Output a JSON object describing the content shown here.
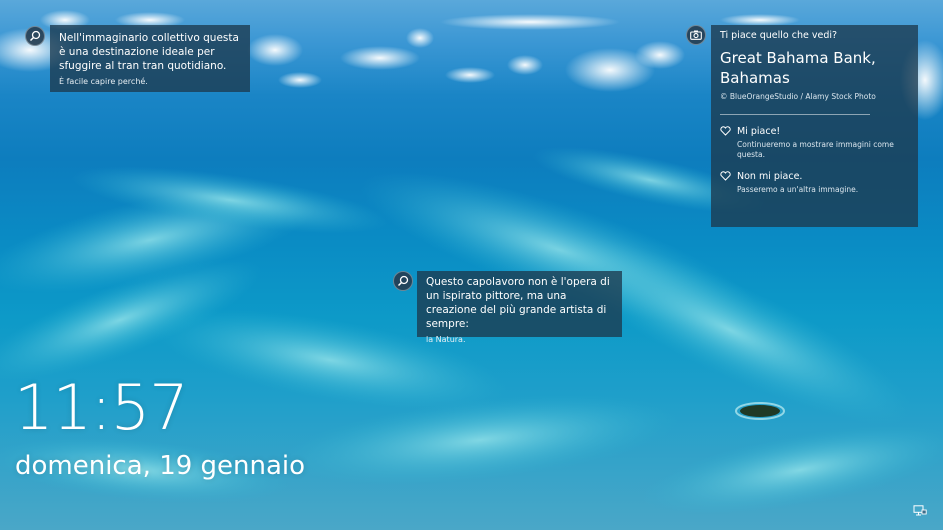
{
  "background": {
    "description_color_sky": "#4fa3d8",
    "description_color_sea": "#0b86c4"
  },
  "hint_top_left": {
    "title": "Nell'immaginario collettivo questa è una destinazione ideale per sfuggire al tran tran quotidiano.",
    "subtitle": "È facile capire perché."
  },
  "hint_center": {
    "title": "Questo capolavoro non è l'opera di un ispirato pittore, ma una creazione del più grande artista di sempre:",
    "subtitle": "la Natura."
  },
  "info_panel": {
    "question": "Ti piace quello che vedi?",
    "location": "Great Bahama Bank, Bahamas",
    "credit": "© BlueOrangeStudio / Alamy Stock Photo",
    "like_label": "Mi piace!",
    "like_desc": "Continueremo a mostrare immagini come questa.",
    "dislike_label": "Non mi piace.",
    "dislike_desc": "Passeremo a un'altra immagine."
  },
  "lock_screen": {
    "time": "11:57",
    "date": "domenica, 19 gennaio"
  },
  "icons": {
    "hint_icon": "magnifier-icon",
    "info_icon": "camera-icon",
    "like_icon": "heart-icon",
    "network_icon": "network-icon"
  }
}
